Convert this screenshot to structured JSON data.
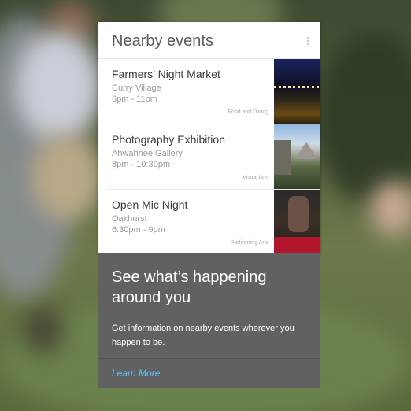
{
  "card": {
    "title": "Nearby events",
    "menu_icon": "overflow-menu-icon"
  },
  "events": [
    {
      "title": "Farmers’ Night Market",
      "place": "Curry Village",
      "time": "6pm - 11pm",
      "category": "Food and Dining",
      "thumb_icon": "night-market-photo"
    },
    {
      "title": "Photography Exhibition",
      "place": "Ahwahnee Gallery",
      "time": "8pm - 10:30pm",
      "category": "Visual Arts",
      "thumb_icon": "valley-landscape-photo"
    },
    {
      "title": "Open Mic Night",
      "place": "Oakhurst",
      "time": "6:30pm - 9pm",
      "category": "Performing Arts",
      "thumb_icon": "musician-photo"
    }
  ],
  "promo": {
    "title": "See what’s happening around you",
    "text": "Get information on nearby events wherever you happen to be.",
    "link": "Learn More"
  },
  "colors": {
    "link": "#5fc6ff",
    "promo_bg": "#616161"
  }
}
